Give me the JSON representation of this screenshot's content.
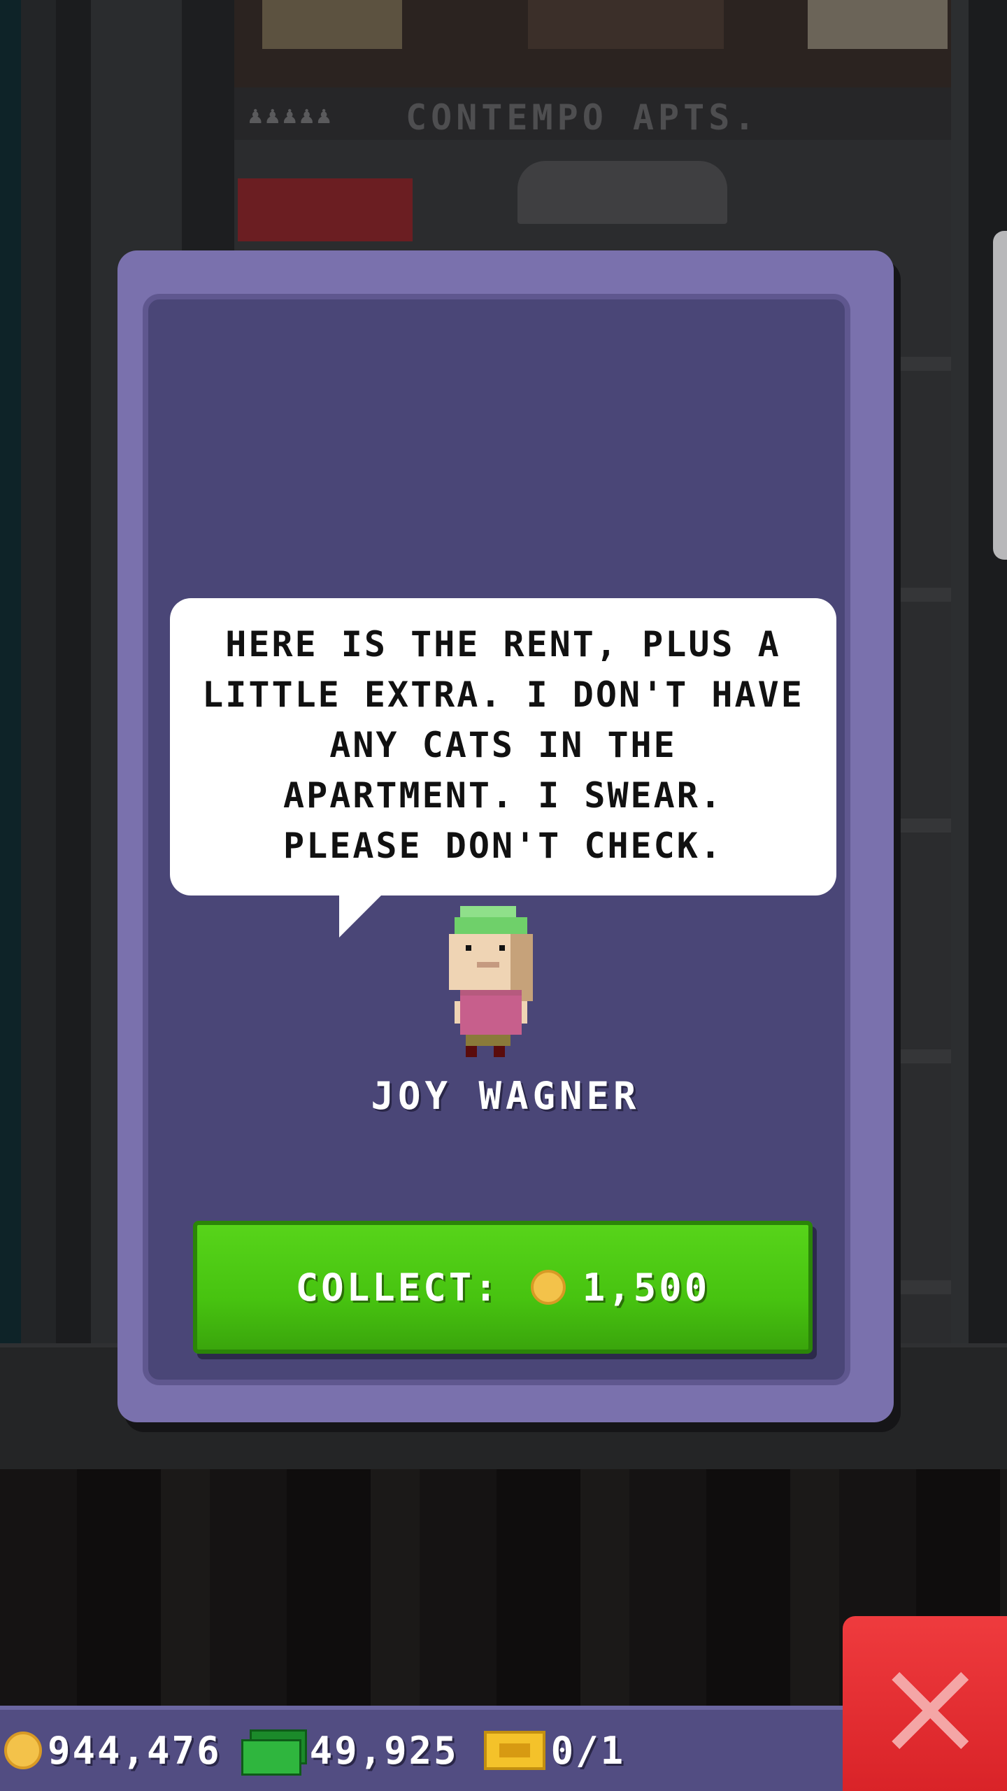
{
  "building": {
    "floor_sign": "CONTEMPO APTS.",
    "occupancy_icon": "people-icon"
  },
  "dialog": {
    "speech": "HERE IS THE RENT, PLUS A\nLITTLE EXTRA. I DON'T HAVE\nANY CATS IN THE\nAPARTMENT. I SWEAR.\nPLEASE DON'T CHECK.",
    "resident_name": "JOY WAGNER",
    "collect_label": "COLLECT:",
    "collect_amount": "1,500",
    "collect_icon": "coin-icon"
  },
  "close_button": {
    "icon": "close-icon",
    "color": "#e02b2f"
  },
  "hud": {
    "coins": "944,476",
    "coins_icon": "coin-icon",
    "bux": "49,925",
    "bux_icon": "bux-icon",
    "tickets": "0/1",
    "tickets_icon": "ticket-icon"
  },
  "colors": {
    "card_outer": "#7a71ad",
    "card_inner": "#4a4677",
    "collect_green": "#47c310",
    "hud_bar": "#524d82"
  }
}
